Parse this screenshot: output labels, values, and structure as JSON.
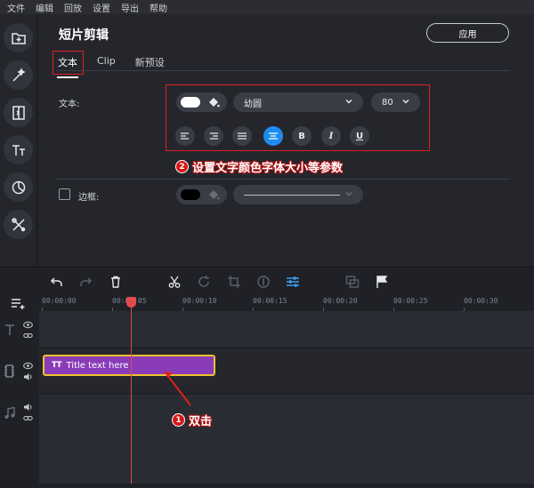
{
  "menu": [
    "文件",
    "编辑",
    "回放",
    "设置",
    "导出",
    "帮助"
  ],
  "panel": {
    "title": "短片剪辑",
    "apply_label": "应用",
    "tabs": [
      "文本",
      "Clip",
      "新预设"
    ],
    "text_label": "文本:",
    "font_value": "幼圆",
    "size_value": "80",
    "border_label": "边框:",
    "text_color": "#ffffff",
    "border_color": "#000000"
  },
  "annotations": {
    "step2_num": "2",
    "step2_text": "设置文字颜色字体大小等参数",
    "step1_num": "1",
    "step1_text": "双击"
  },
  "timeline": {
    "ruler": [
      "00:00:00",
      "00:00:05",
      "00:00:10",
      "00:00:15",
      "00:00:20",
      "00:00:25",
      "00:00:30"
    ],
    "clip_icon": "TT",
    "clip_label": "Title text here"
  },
  "colors": {
    "accent": "#1d8cf0",
    "clip": "#8a3cb8",
    "clip_border": "#f0c030",
    "playhead": "#e04a4a",
    "annotation": "#e02020"
  },
  "icons": {
    "tools": [
      "import-icon",
      "magic-wand-icon",
      "transition-icon",
      "text-icon",
      "filter-icon",
      "tools-icon"
    ],
    "toolbar": [
      "undo-icon",
      "redo-icon",
      "delete-icon",
      "cut-icon",
      "rotate-icon",
      "crop-icon",
      "color-icon",
      "adjust-icon",
      "overlay-icon",
      "flag-icon"
    ]
  }
}
